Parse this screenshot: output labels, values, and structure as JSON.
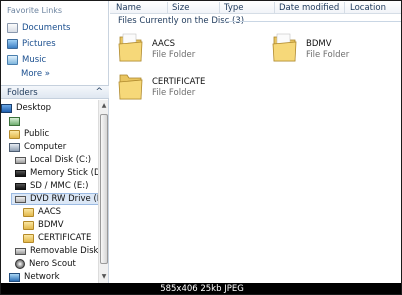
{
  "favorites": {
    "title": "Favorite Links",
    "items": [
      {
        "label": "Documents",
        "icon": "documents-icon"
      },
      {
        "label": "Pictures",
        "icon": "pictures-icon"
      },
      {
        "label": "Music",
        "icon": "music-icon"
      }
    ],
    "more_label": "More",
    "more_chevron": "»"
  },
  "folders": {
    "label": "Folders",
    "chevron": "^"
  },
  "tree": [
    {
      "label": "Desktop",
      "icon": "desktop-icon"
    },
    {
      "label": "",
      "icon": "user-folder-icon"
    },
    {
      "label": "Public",
      "icon": "folder-icon"
    },
    {
      "label": "Computer",
      "icon": "computer-icon"
    },
    {
      "label": "Local Disk (C:)",
      "icon": "hard-disk-icon"
    },
    {
      "label": "Memory Stick (D:)",
      "icon": "memory-card-icon"
    },
    {
      "label": "SD / MMC (E:)",
      "icon": "memory-card-icon"
    },
    {
      "label": "DVD RW Drive (F:)",
      "icon": "dvd-drive-icon"
    },
    {
      "label": "AACS",
      "icon": "folder-icon"
    },
    {
      "label": "BDMV",
      "icon": "folder-icon"
    },
    {
      "label": "CERTIFICATE",
      "icon": "folder-icon"
    },
    {
      "label": "Removable Disk (G",
      "icon": "removable-disk-icon"
    },
    {
      "label": "Nero Scout",
      "icon": "nero-scout-icon"
    },
    {
      "label": "Network",
      "icon": "network-icon"
    }
  ],
  "columns": [
    "Name",
    "Size",
    "Type",
    "Date modified",
    "Location"
  ],
  "group": {
    "label": "Files Currently on the Disc",
    "count": "(3)"
  },
  "files": [
    {
      "name": "AACS",
      "type": "File Folder"
    },
    {
      "name": "BDMV",
      "type": "File Folder"
    },
    {
      "name": "CERTIFICATE",
      "type": "File Folder"
    }
  ],
  "caption": "585x406  25kb  JPEG",
  "colors": {
    "link": "#1b4f8f",
    "header_text": "#1e395b",
    "selection": "#dbe7f6",
    "folder_yellow": "#e2b84c"
  }
}
